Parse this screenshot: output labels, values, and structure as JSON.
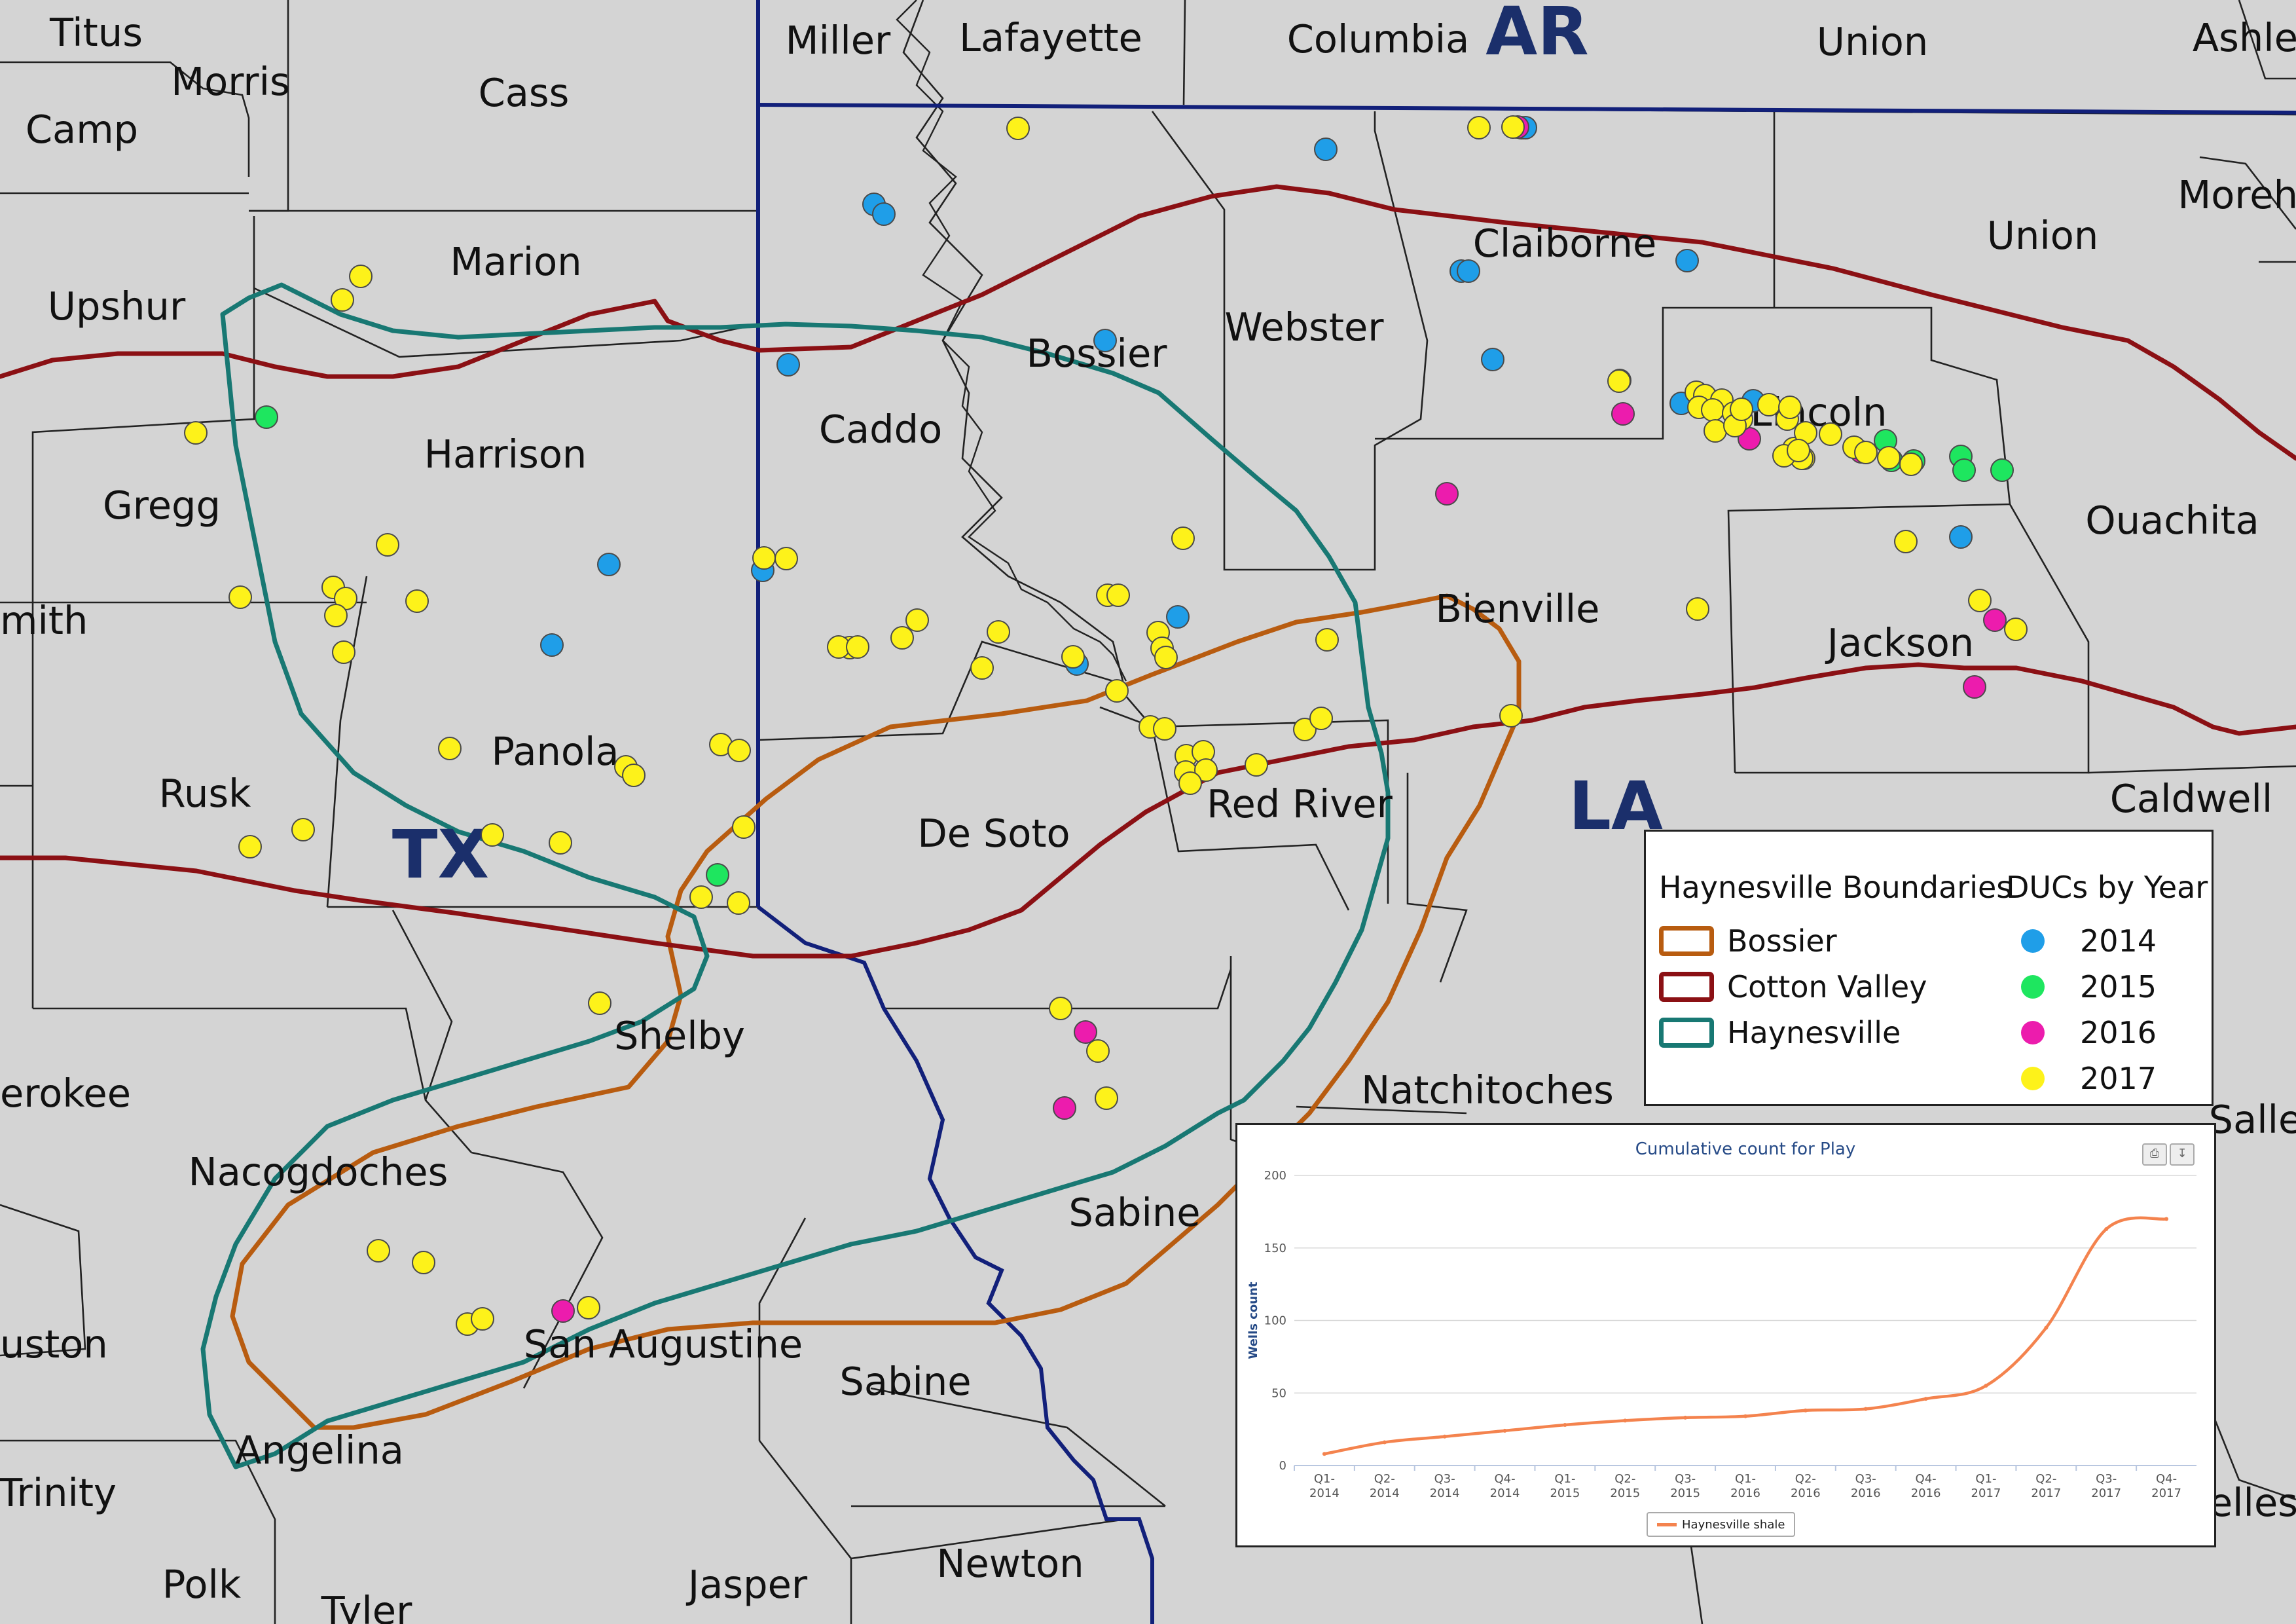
{
  "map": {
    "background": "#d4d4d4",
    "states": [
      {
        "id": "tx",
        "label": "TX"
      },
      {
        "id": "ar",
        "label": "AR"
      },
      {
        "id": "la",
        "label": "LA"
      }
    ],
    "counties": [
      {
        "id": "titus",
        "label": "Titus"
      },
      {
        "id": "morris",
        "label": "Morris"
      },
      {
        "id": "camp",
        "label": "Camp"
      },
      {
        "id": "cass",
        "label": "Cass"
      },
      {
        "id": "miller",
        "label": "Miller"
      },
      {
        "id": "lafayette",
        "label": "Lafayette"
      },
      {
        "id": "columbia",
        "label": "Columbia"
      },
      {
        "id": "union-ar",
        "label": "Union"
      },
      {
        "id": "ashley",
        "label": "Ashle"
      },
      {
        "id": "upshur",
        "label": "Upshur"
      },
      {
        "id": "marion",
        "label": "Marion"
      },
      {
        "id": "morehouse",
        "label": "Moreh"
      },
      {
        "id": "claiborne",
        "label": "Claiborne"
      },
      {
        "id": "union-la",
        "label": "Union"
      },
      {
        "id": "webster",
        "label": "Webster"
      },
      {
        "id": "bossier",
        "label": "Bossier"
      },
      {
        "id": "caddo",
        "label": "Caddo"
      },
      {
        "id": "harrison",
        "label": "Harrison"
      },
      {
        "id": "gregg",
        "label": "Gregg"
      },
      {
        "id": "lincoln",
        "label": "Lincoln"
      },
      {
        "id": "ouachita",
        "label": "Ouachita"
      },
      {
        "id": "smith",
        "label": "mith"
      },
      {
        "id": "bienville",
        "label": "Bienville"
      },
      {
        "id": "jackson",
        "label": "Jackson"
      },
      {
        "id": "panola",
        "label": "Panola"
      },
      {
        "id": "rusk",
        "label": "Rusk"
      },
      {
        "id": "desoto",
        "label": "De Soto"
      },
      {
        "id": "redriver",
        "label": "Red River"
      },
      {
        "id": "caldwell",
        "label": "Caldwell"
      },
      {
        "id": "shelby",
        "label": "Shelby"
      },
      {
        "id": "cherokee",
        "label": "erokee"
      },
      {
        "id": "natchitoches",
        "label": "Natchitoches"
      },
      {
        "id": "lasalle",
        "label": "Salle"
      },
      {
        "id": "nacogdoches",
        "label": "Nacogdoches"
      },
      {
        "id": "sabine-la",
        "label": "Sabine"
      },
      {
        "id": "houston",
        "label": "uston"
      },
      {
        "id": "sanaugustine",
        "label": "San Augustine"
      },
      {
        "id": "sabine-tx",
        "label": "Sabine"
      },
      {
        "id": "angelina",
        "label": "Angelina"
      },
      {
        "id": "trinity",
        "label": "Trinity"
      },
      {
        "id": "grant",
        "label": "yelles"
      },
      {
        "id": "polk",
        "label": "Polk"
      },
      {
        "id": "tyler",
        "label": "Tyler"
      },
      {
        "id": "jasper",
        "label": "Jasper"
      },
      {
        "id": "newton",
        "label": "Newton"
      }
    ],
    "boundaries": [
      {
        "name": "Bossier",
        "color": "#b85c10"
      },
      {
        "name": "Cotton Valley",
        "color": "#8b1014"
      },
      {
        "name": "Haynesville",
        "color": "#187873"
      }
    ],
    "duc_wells": {
      "count_by_year": {
        "2014": 24,
        "2015": 10,
        "2016": 10,
        "2017": 113
      },
      "colors": {
        "2014": "#1f9ee8",
        "2015": "#1ee65f",
        "2016": "#ec1cad",
        "2017": "#fdf21a"
      }
    }
  },
  "legend": {
    "boundaries_title": "Haynesville Boundaries",
    "ducs_title": "DUCs by Year",
    "boundaries": [
      {
        "label": "Bossier",
        "color": "#b85c10"
      },
      {
        "label": "Cotton Valley",
        "color": "#8b1014"
      },
      {
        "label": "Haynesville",
        "color": "#187873"
      }
    ],
    "years": [
      {
        "label": "2014",
        "color": "#1f9ee8"
      },
      {
        "label": "2015",
        "color": "#1ee65f"
      },
      {
        "label": "2016",
        "color": "#ec1cad"
      },
      {
        "label": "2017",
        "color": "#fdf21a"
      }
    ]
  },
  "chart_data": {
    "type": "line",
    "title": "Cumulative count for Play",
    "ylabel": "Wells count",
    "xlabel": "",
    "ylim": [
      0,
      200
    ],
    "yticks": [
      0,
      50,
      100,
      150,
      200
    ],
    "categories": [
      "Q1-2014",
      "Q2-2014",
      "Q3-2014",
      "Q4-2014",
      "Q1-2015",
      "Q2-2015",
      "Q3-2015",
      "Q1-2016",
      "Q2-2016",
      "Q3-2016",
      "Q4-2016",
      "Q1-2017",
      "Q2-2017",
      "Q3-2017",
      "Q4-2017"
    ],
    "category_lines": [
      [
        "Q1-",
        "2014"
      ],
      [
        "Q2-",
        "2014"
      ],
      [
        "Q3-",
        "2014"
      ],
      [
        "Q4-",
        "2014"
      ],
      [
        "Q1-",
        "2015"
      ],
      [
        "Q2-",
        "2015"
      ],
      [
        "Q3-",
        "2015"
      ],
      [
        "Q1-",
        "2016"
      ],
      [
        "Q2-",
        "2016"
      ],
      [
        "Q3-",
        "2016"
      ],
      [
        "Q4-",
        "2016"
      ],
      [
        "Q1-",
        "2017"
      ],
      [
        "Q2-",
        "2017"
      ],
      [
        "Q3-",
        "2017"
      ],
      [
        "Q4-",
        "2017"
      ]
    ],
    "series": [
      {
        "name": "Haynesville shale",
        "color": "#f4834e",
        "values": [
          8,
          16,
          20,
          24,
          28,
          31,
          33,
          34,
          38,
          39,
          46,
          55,
          95,
          163,
          170
        ]
      }
    ],
    "legend_position": "bottom-center",
    "grid": true
  }
}
